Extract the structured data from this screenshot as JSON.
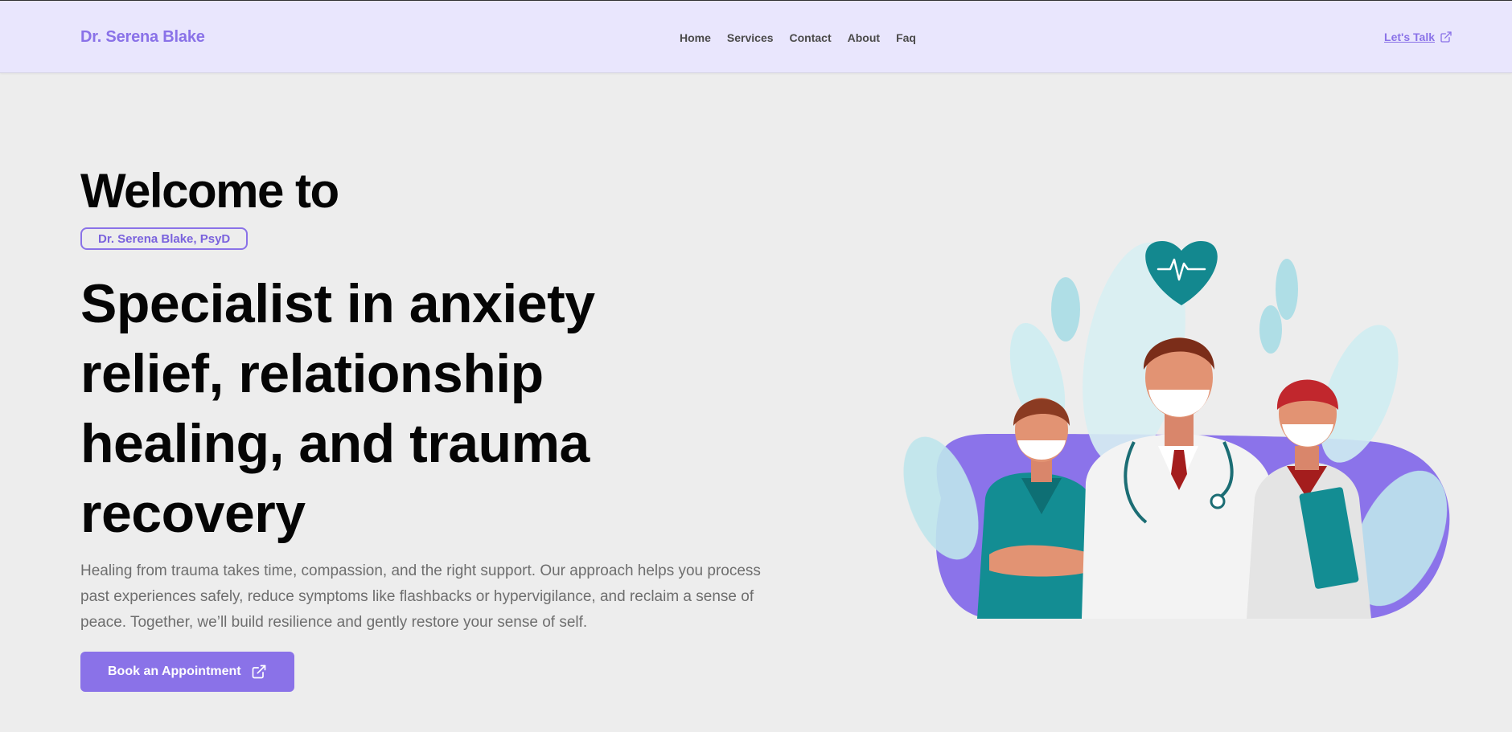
{
  "header": {
    "brand": "Dr. Serena Blake",
    "nav": [
      "Home",
      "Services",
      "Contact",
      "About",
      "Faq"
    ],
    "cta_label": "Let's Talk"
  },
  "hero": {
    "welcome": "Welcome to",
    "badge": "Dr. Serena Blake, PsyD",
    "headline": "Specialist in anxiety relief, relationship healing, and trauma recovery",
    "description": "Healing from trauma takes time, compassion, and the right support. Our approach helps you process past experiences safely, reduce symptoms like flashbacks or hypervigilance, and reclaim a sense of peace. Together, we’ll build resilience and gently restore your sense of self.",
    "button_label": "Book an Appointment"
  },
  "colors": {
    "accent": "#8a72e8",
    "header_bg": "#e9e6fd",
    "page_bg": "#ededed",
    "teal": "#138d93"
  },
  "icons": {
    "external_link": "external-link-icon",
    "heart": "heartbeat-icon"
  }
}
